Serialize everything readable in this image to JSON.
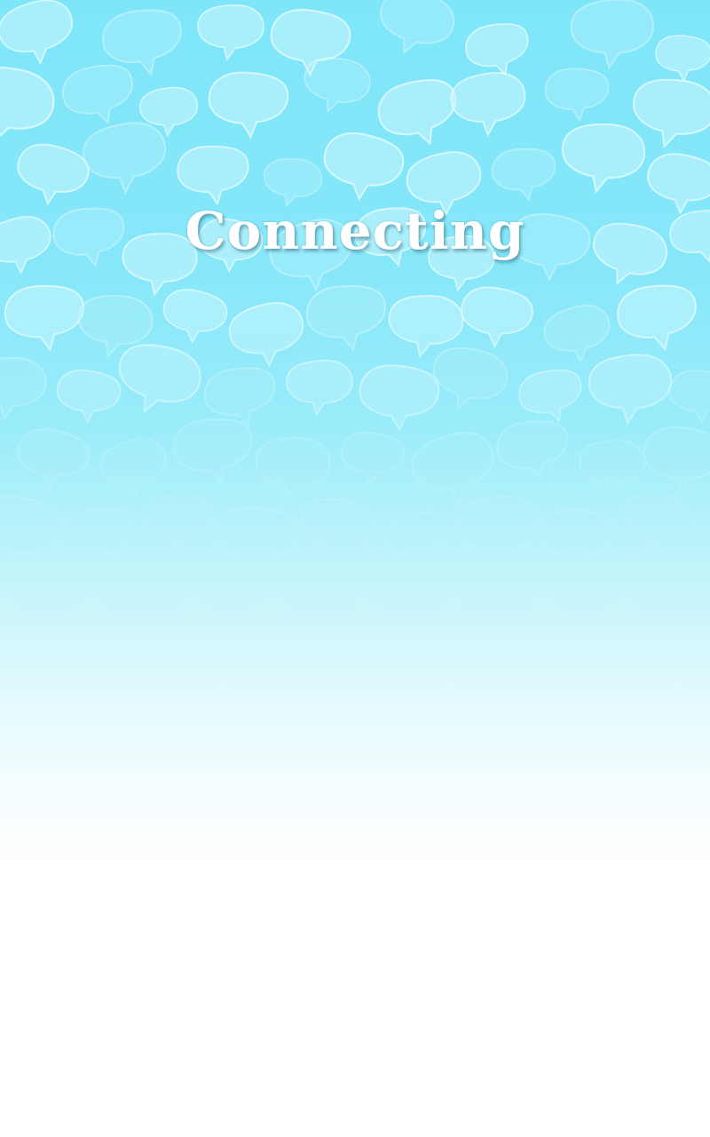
{
  "screen": {
    "status_title": "Connecting"
  },
  "background": {
    "pattern_icon": "speech-bubble-icon",
    "colors": {
      "top": "#7fe6f9",
      "bottom": "#ffffff",
      "bubble_fill": "#c8f5fd"
    }
  }
}
